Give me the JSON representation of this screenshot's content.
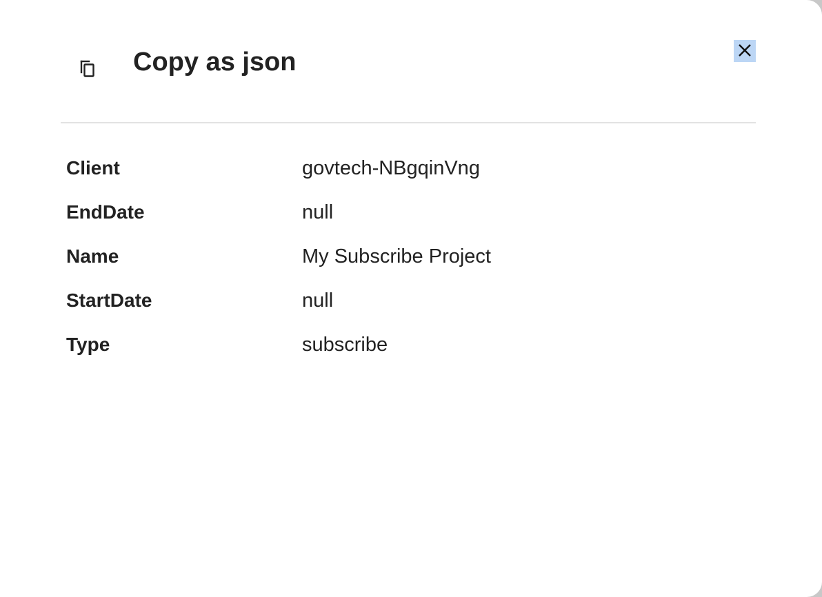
{
  "dialog": {
    "title": "Copy as json",
    "icon": "copy-icon",
    "close_icon": "close-icon",
    "accent_close_bg": "#bcd6f5"
  },
  "fields": [
    {
      "key": "Client",
      "value": "govtech-NBgqinVng"
    },
    {
      "key": "EndDate",
      "value": "null"
    },
    {
      "key": "Name",
      "value": "My Subscribe Project"
    },
    {
      "key": "StartDate",
      "value": "null"
    },
    {
      "key": "Type",
      "value": "subscribe"
    }
  ]
}
